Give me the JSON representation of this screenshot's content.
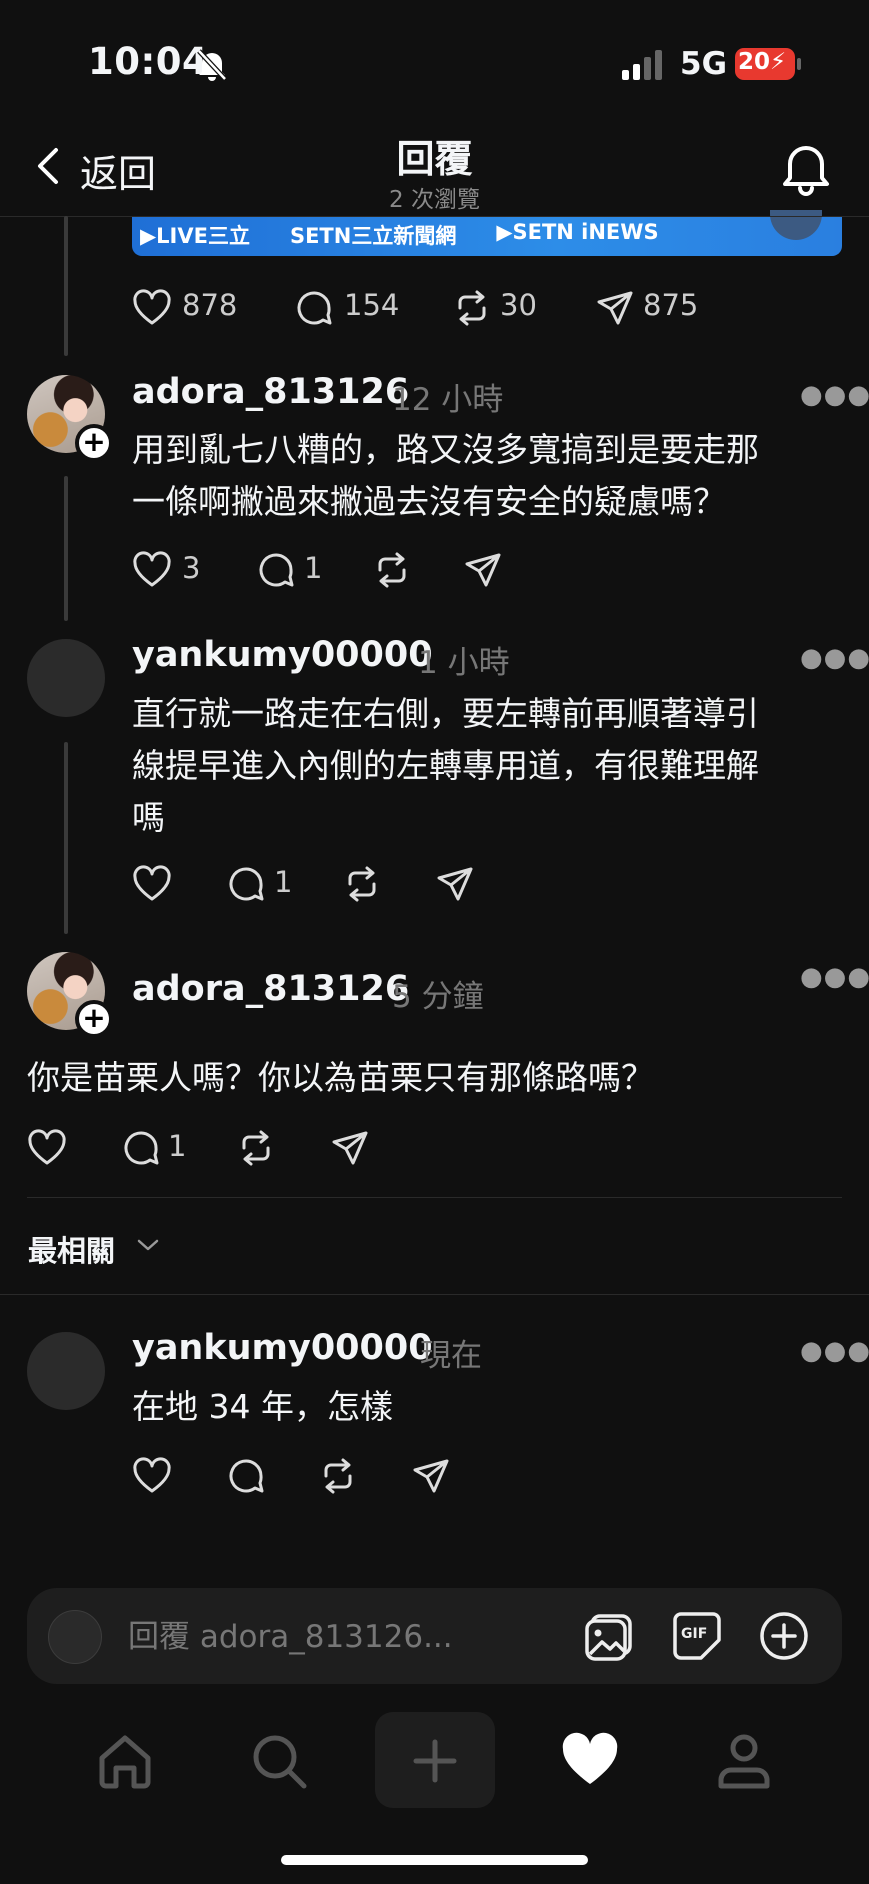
{
  "status_bar": {
    "time": "10:04",
    "network": "5G",
    "battery": "20"
  },
  "header": {
    "back_label": "返回",
    "title": "回覆",
    "subtitle": "2 次瀏覽"
  },
  "banner": {
    "items": [
      "▶LIVE三立",
      "SETN三立新聞網",
      "▶SETN iNEWS"
    ]
  },
  "main_post_actions": {
    "likes": "878",
    "replies": "154",
    "reposts": "30",
    "shares": "875"
  },
  "replies": [
    {
      "username": "adora_813126",
      "time": "12 小時",
      "lines": [
        "用到亂七八糟的，路又沒多寬搞到是要走那",
        "一條啊撇過來撇過去沒有安全的疑慮嗎？"
      ],
      "likes": "3",
      "replies": "1"
    },
    {
      "username": "yankumy00000",
      "time": "1 小時",
      "lines": [
        "直行就一路走在右側，要左轉前再順著導引",
        "線提早進入內側的左轉專用道，有很難理解",
        "嗎"
      ],
      "likes": "",
      "replies": "1"
    },
    {
      "username": "adora_813126",
      "time": "5 分鐘",
      "lines": [
        "你是苗栗人嗎？你以為苗栗只有那條路嗎？"
      ],
      "likes": "",
      "replies": "1"
    },
    {
      "username": "yankumy00000",
      "time": "現在",
      "lines": [
        "在地 34 年，怎樣"
      ],
      "likes": "",
      "replies": ""
    }
  ],
  "sort": {
    "label": "最相關"
  },
  "composer": {
    "placeholder": "回覆 adora_813126..."
  },
  "icons": [
    "bell-slash-icon",
    "signal-icon",
    "back-chevron-icon",
    "bell-icon",
    "heart-icon",
    "comment-icon",
    "repost-icon",
    "send-icon",
    "more-icon",
    "image-icon",
    "gif-icon",
    "plus-circle-icon",
    "home-icon",
    "search-icon",
    "plus-icon",
    "heart-filled-icon",
    "profile-icon"
  ],
  "colors": {
    "background": "#101010",
    "text": "#f3f5f7",
    "muted": "#777777",
    "battery": "#e8392f",
    "banner": "#2d8de8"
  }
}
